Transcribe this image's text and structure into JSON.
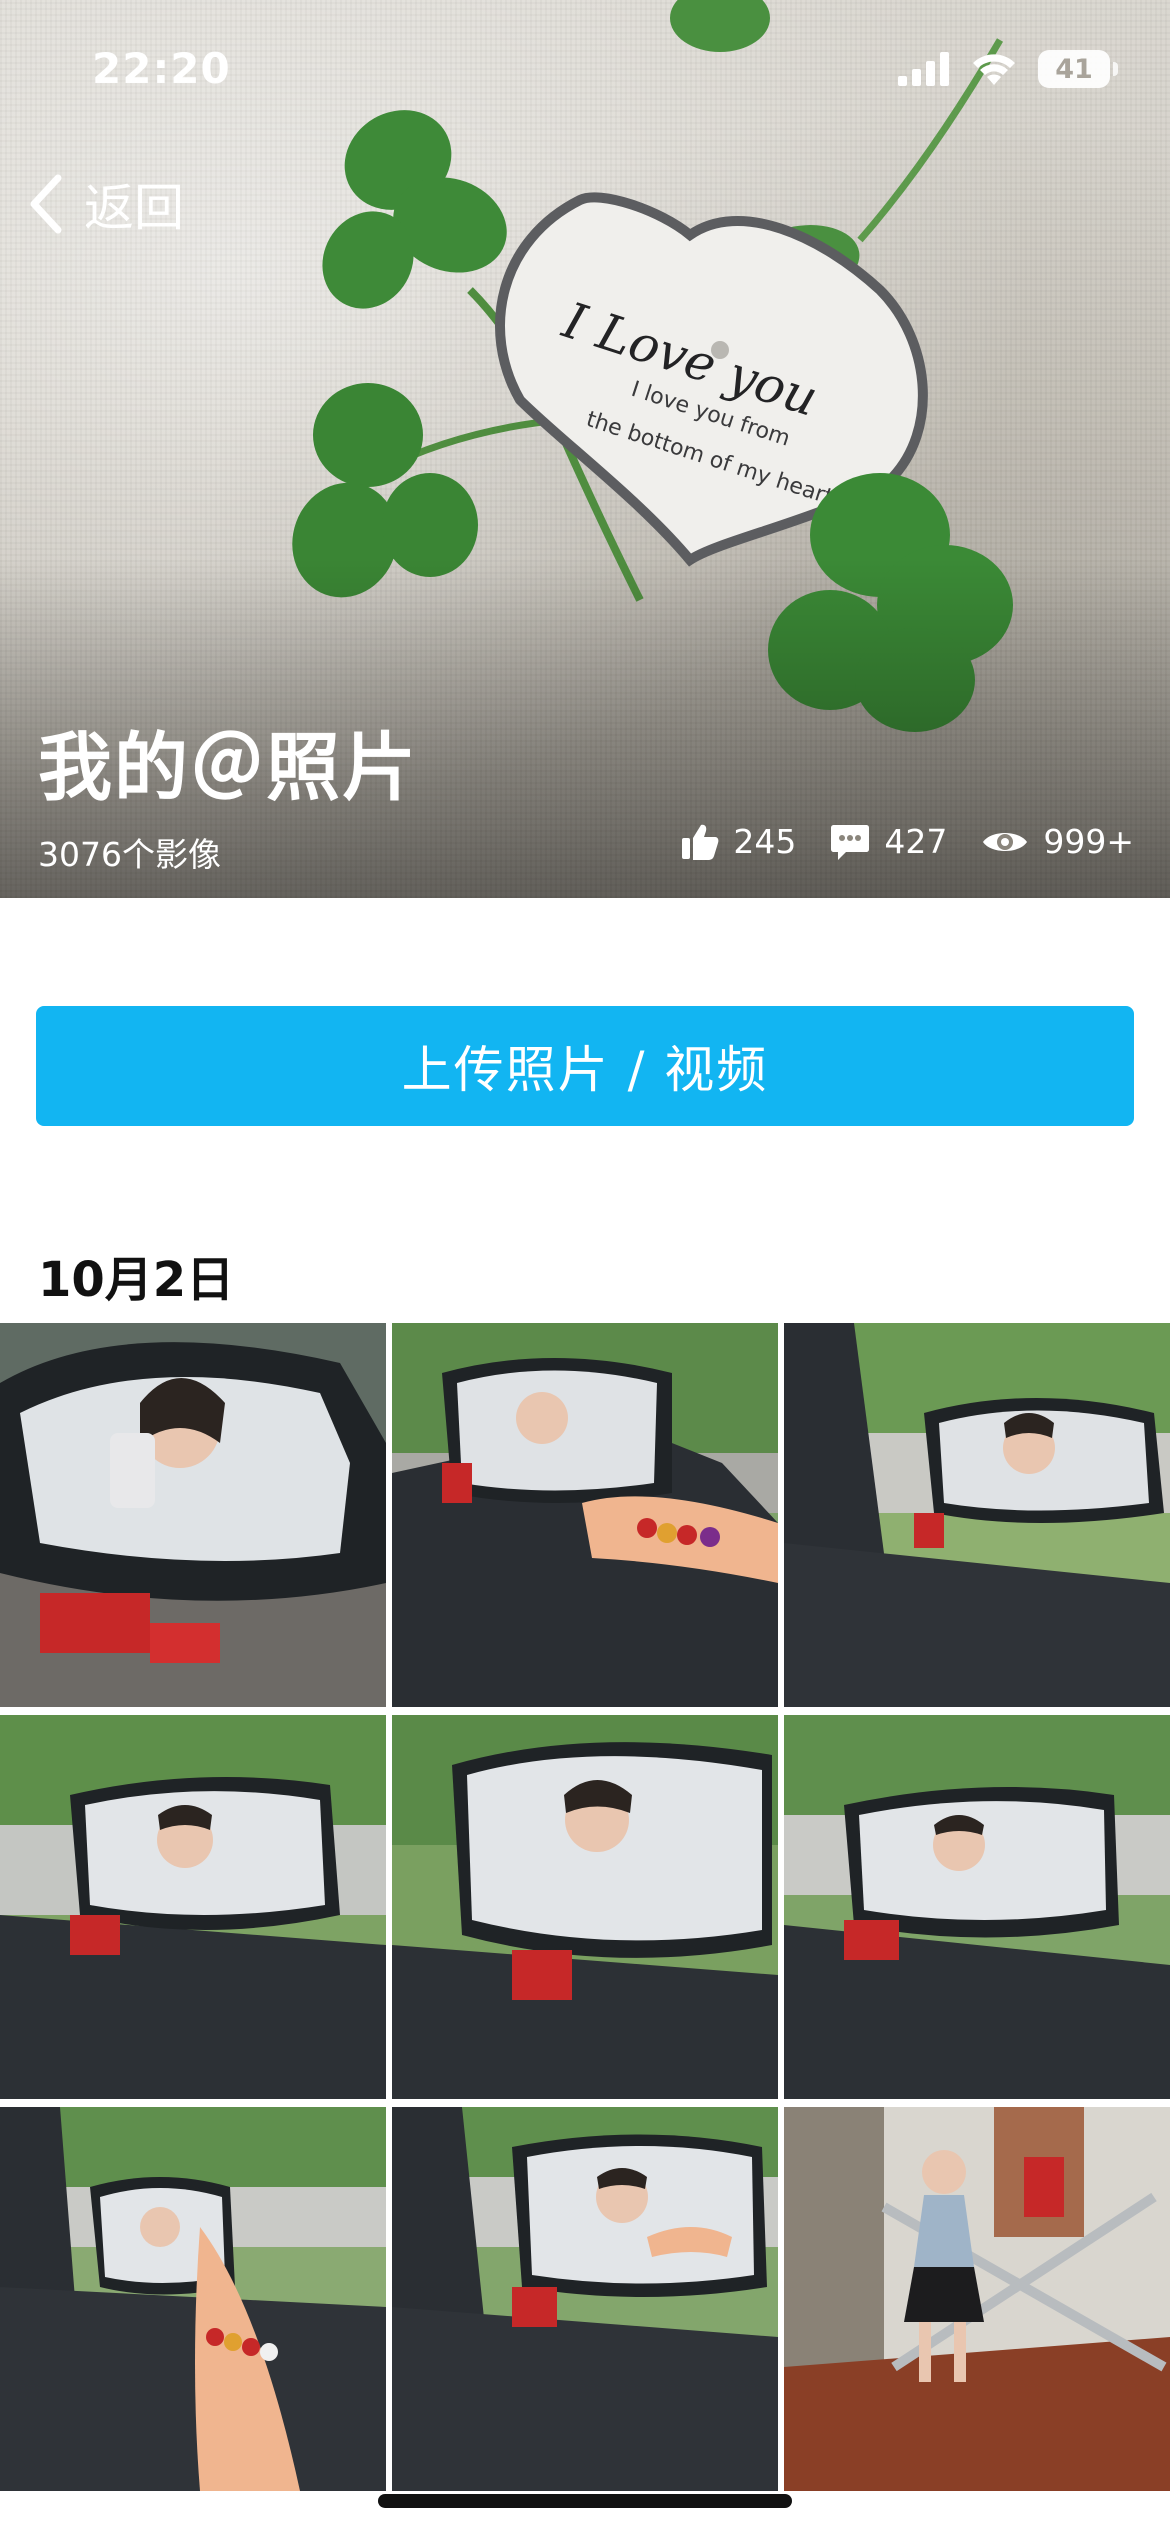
{
  "status_bar": {
    "time": "22:20",
    "battery": "41",
    "icons": [
      "cellular-signal-icon",
      "wifi-icon",
      "battery-icon"
    ]
  },
  "nav": {
    "back_label": "返回",
    "back_icon": "chevron-left-icon"
  },
  "album": {
    "title": "我的＠照片",
    "count": "3076个影像",
    "cover_text": {
      "line1": "I Love you",
      "line2": "I love you from",
      "line3": "the bottom of  my heart"
    }
  },
  "stats": {
    "likes": "245",
    "comments": "427",
    "views": "999+",
    "icons": [
      "thumbs-up-icon",
      "comment-icon",
      "eye-icon"
    ]
  },
  "upload": {
    "label": "上传照片 / 视频"
  },
  "section": {
    "date": "10月2日"
  },
  "photos": [
    {
      "subject": "car-side-mirror-selfie"
    },
    {
      "subject": "car-mirror-with-bracelet-hand"
    },
    {
      "subject": "car-side-mirror-selfie"
    },
    {
      "subject": "car-side-mirror-selfie"
    },
    {
      "subject": "car-side-mirror-selfie"
    },
    {
      "subject": "car-side-mirror-selfie"
    },
    {
      "subject": "car-mirror-with-bracelet-hand"
    },
    {
      "subject": "car-side-mirror-selfie"
    },
    {
      "subject": "mirror-selfie-lobby"
    }
  ],
  "colors": {
    "accent": "#12b5f2",
    "title_text": "#ffffff",
    "section_text": "#111111",
    "clover_green": "#3f8a3a",
    "mirror_frame": "#1f2326"
  }
}
